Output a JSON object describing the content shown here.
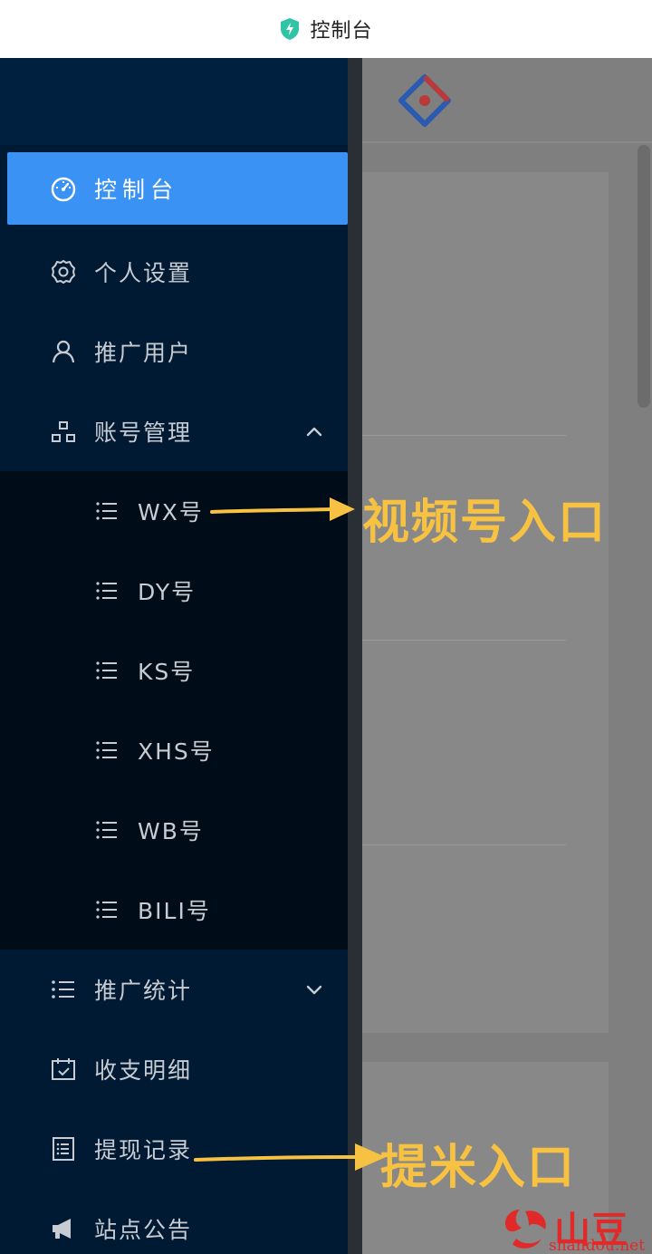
{
  "titlebar": {
    "title": "控制台",
    "app_icon": "shield-bolt-icon",
    "accent": "#2fc4a5"
  },
  "sidebar": {
    "active_color": "#3a93f4",
    "items": [
      {
        "label": "控制台",
        "icon": "dashboard-icon",
        "active": true
      },
      {
        "label": "个人设置",
        "icon": "gear-icon"
      },
      {
        "label": "推广用户",
        "icon": "user-icon"
      },
      {
        "label": "账号管理",
        "icon": "sitemap-icon",
        "expanded": true,
        "chevron": "chevron-up-icon"
      }
    ],
    "submenu": [
      {
        "label": "WX号",
        "icon": "list-icon"
      },
      {
        "label": "DY号",
        "icon": "list-icon"
      },
      {
        "label": "KS号",
        "icon": "list-icon"
      },
      {
        "label": "XHS号",
        "icon": "list-icon"
      },
      {
        "label": "WB号",
        "icon": "list-icon"
      },
      {
        "label": "BILI号",
        "icon": "list-icon"
      }
    ],
    "items_after": [
      {
        "label": "推广统计",
        "icon": "list-icon",
        "chevron": "chevron-down-icon"
      },
      {
        "label": "收支明细",
        "icon": "calendar-check-icon"
      },
      {
        "label": "提现记录",
        "icon": "document-list-icon"
      },
      {
        "label": "站点公告",
        "icon": "megaphone-icon"
      }
    ]
  },
  "annotations": {
    "video_entry": "视频号入口",
    "withdraw_entry": "提米入口",
    "color": "#f7c242"
  },
  "watermark": {
    "text": "山豆网",
    "sub": "shandou.net",
    "color": "#e02a2a"
  }
}
